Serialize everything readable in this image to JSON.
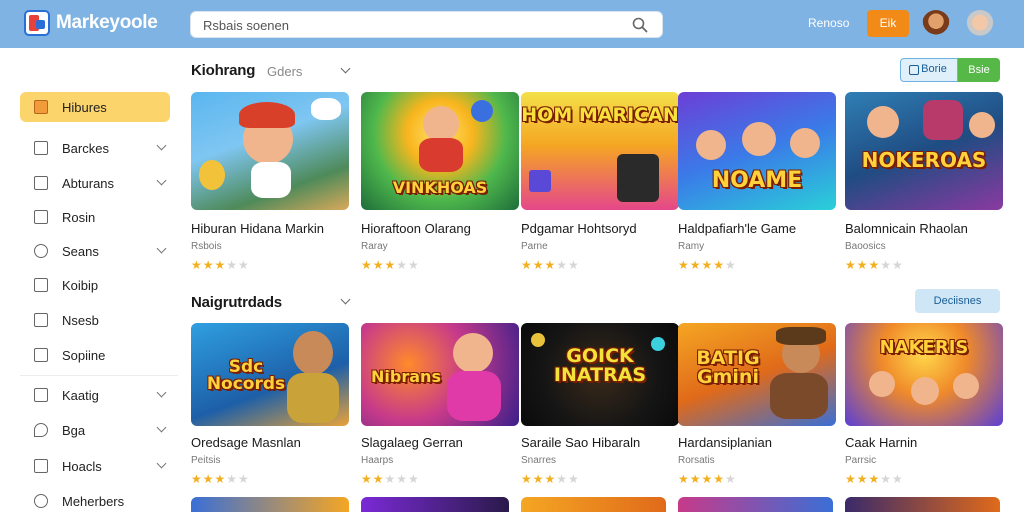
{
  "app": {
    "name": "Markeyoole"
  },
  "search": {
    "placeholder": "Rsbais soenen"
  },
  "topnav": {
    "link": "Renoso",
    "button": "Eik"
  },
  "sidebar": {
    "items": [
      {
        "label": "Hibures",
        "icon": "home-icon",
        "active": true,
        "chevron": false
      },
      {
        "label": "Barckes",
        "icon": "folder-icon",
        "chevron": true
      },
      {
        "label": "Abturans",
        "icon": "briefcase-icon",
        "chevron": true
      },
      {
        "label": "Rosin",
        "icon": "document-icon",
        "chevron": false
      },
      {
        "label": "Seans",
        "icon": "settings-icon",
        "chevron": true
      },
      {
        "label": "Koibip",
        "icon": "calendar-icon",
        "chevron": false
      },
      {
        "label": "Nsesb",
        "icon": "edit-icon",
        "chevron": false
      },
      {
        "label": "Sopiine",
        "icon": "list-icon",
        "chevron": false
      },
      {
        "label": "Kaatig",
        "icon": "tag-icon",
        "chevron": true
      },
      {
        "label": "Bga",
        "icon": "chat-icon",
        "chevron": true
      },
      {
        "label": "Hoacls",
        "icon": "grid-icon",
        "chevron": true
      },
      {
        "label": "Meherbers",
        "icon": "users-icon",
        "chevron": false
      }
    ]
  },
  "section1": {
    "title": "Kiohrang",
    "sort": "Gders",
    "button_primary": "Borie",
    "button_secondary": "Bsie",
    "cards": [
      {
        "art": "",
        "title": "Hiburan Hidana Markin",
        "sub": "Rsbois",
        "rating": 3
      },
      {
        "art": "VINKHOAS",
        "title": "Hioraftoon Olarang",
        "sub": "Raray",
        "rating": 3
      },
      {
        "art": "HOM MARICAN",
        "title": "Pdgamar Hohtsoryd",
        "sub": "Parne",
        "rating": 3
      },
      {
        "art": "NOAME",
        "title": "Haldpafiarh'le Game",
        "sub": "Ramy",
        "rating": 4
      },
      {
        "art": "NOKEROAS",
        "title": "Balomnicain Rhaolan",
        "sub": "Baoosics",
        "rating": 3
      }
    ]
  },
  "section2": {
    "title": "Naigrutrdads",
    "button": "Deciisnes",
    "cards": [
      {
        "art": "Sdc Nocords",
        "title": "Oredsage Masnlan",
        "sub": "Peitsis",
        "rating": 3
      },
      {
        "art": "Nibrans",
        "title": "Slagalaeg Gerran",
        "sub": "Haarps",
        "rating": 2
      },
      {
        "art": "GOICK INATRAS",
        "title": "Saraile Sao Hibaraln",
        "sub": "Snarres",
        "rating": 3
      },
      {
        "art": "BATIG Gmini",
        "title": "Hardansiplanian",
        "sub": "Rorsatis",
        "rating": 4
      },
      {
        "art": "NAKERIS",
        "title": "Caak Harnin",
        "sub": "Parrsic",
        "rating": 3
      }
    ]
  },
  "theme": {
    "topbar": "#7fb3e3",
    "accent_orange": "#f28a18",
    "active_nav": "#fcd46c",
    "star": "#f2b01e",
    "green": "#56b846"
  }
}
